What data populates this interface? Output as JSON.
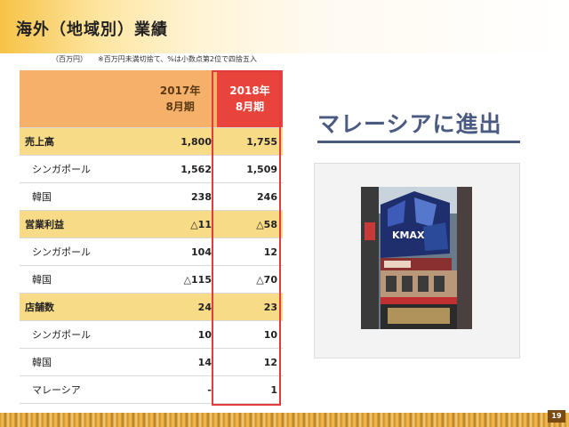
{
  "header": {
    "title": "海外（地域別）業績",
    "unit_note": "（百万円）",
    "rounding_note": "※百万円未満切捨て、%は小数点第2位で四捨五入"
  },
  "table": {
    "col_2017": [
      "2017年",
      "8月期"
    ],
    "col_2018": [
      "2018年",
      "8月期"
    ],
    "rows": [
      {
        "label": "売上高",
        "v2017": "1,800",
        "v2018": "1,755",
        "type": "category"
      },
      {
        "label": "シンガポール",
        "v2017": "1,562",
        "v2018": "1,509",
        "type": "sub"
      },
      {
        "label": "韓国",
        "v2017": "238",
        "v2018": "246",
        "type": "sub"
      },
      {
        "label": "営業利益",
        "v2017": "△11",
        "v2018": "△58",
        "type": "category"
      },
      {
        "label": "シンガポール",
        "v2017": "104",
        "v2018": "12",
        "type": "sub"
      },
      {
        "label": "韓国",
        "v2017": "△115",
        "v2018": "△70",
        "type": "sub"
      },
      {
        "label": "店舗数",
        "v2017": "24",
        "v2018": "23",
        "type": "category"
      },
      {
        "label": "シンガポール",
        "v2017": "10",
        "v2018": "10",
        "type": "sub"
      },
      {
        "label": "韓国",
        "v2017": "14",
        "v2018": "12",
        "type": "sub"
      },
      {
        "label": "マレーシア",
        "v2017": "-",
        "v2018": "1",
        "type": "sub"
      }
    ]
  },
  "malaysia": {
    "title": "マレーシアに進出",
    "sign_text": "KMAX"
  },
  "footer": {
    "page_number": "19"
  },
  "colors": {
    "category_row": "#f8db86",
    "header_2017": "#f5b06a",
    "header_2018": "#e8443c",
    "highlight": "#e23b3b",
    "title_blue": "#4a5a80"
  }
}
